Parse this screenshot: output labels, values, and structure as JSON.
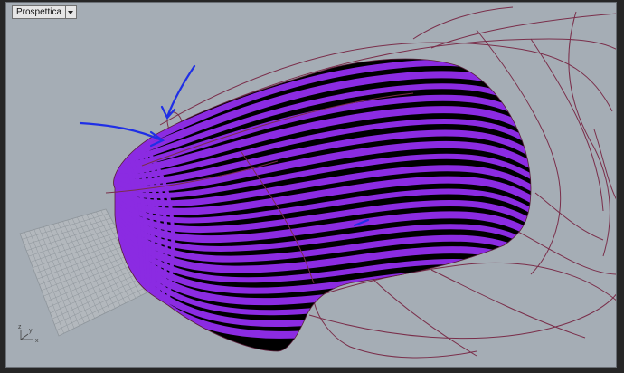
{
  "viewport": {
    "name": "Prospettica",
    "menu_icon": "chevron-down-icon"
  },
  "axis_widget": {
    "x_label": "x",
    "y_label": "y",
    "z_label": "z"
  },
  "colors": {
    "background": "#a5adb5",
    "zebra_light": "#8b2be2",
    "zebra_dark": "#000000",
    "curves": "#7a2e4a",
    "annotation": "#1f2fe6"
  }
}
